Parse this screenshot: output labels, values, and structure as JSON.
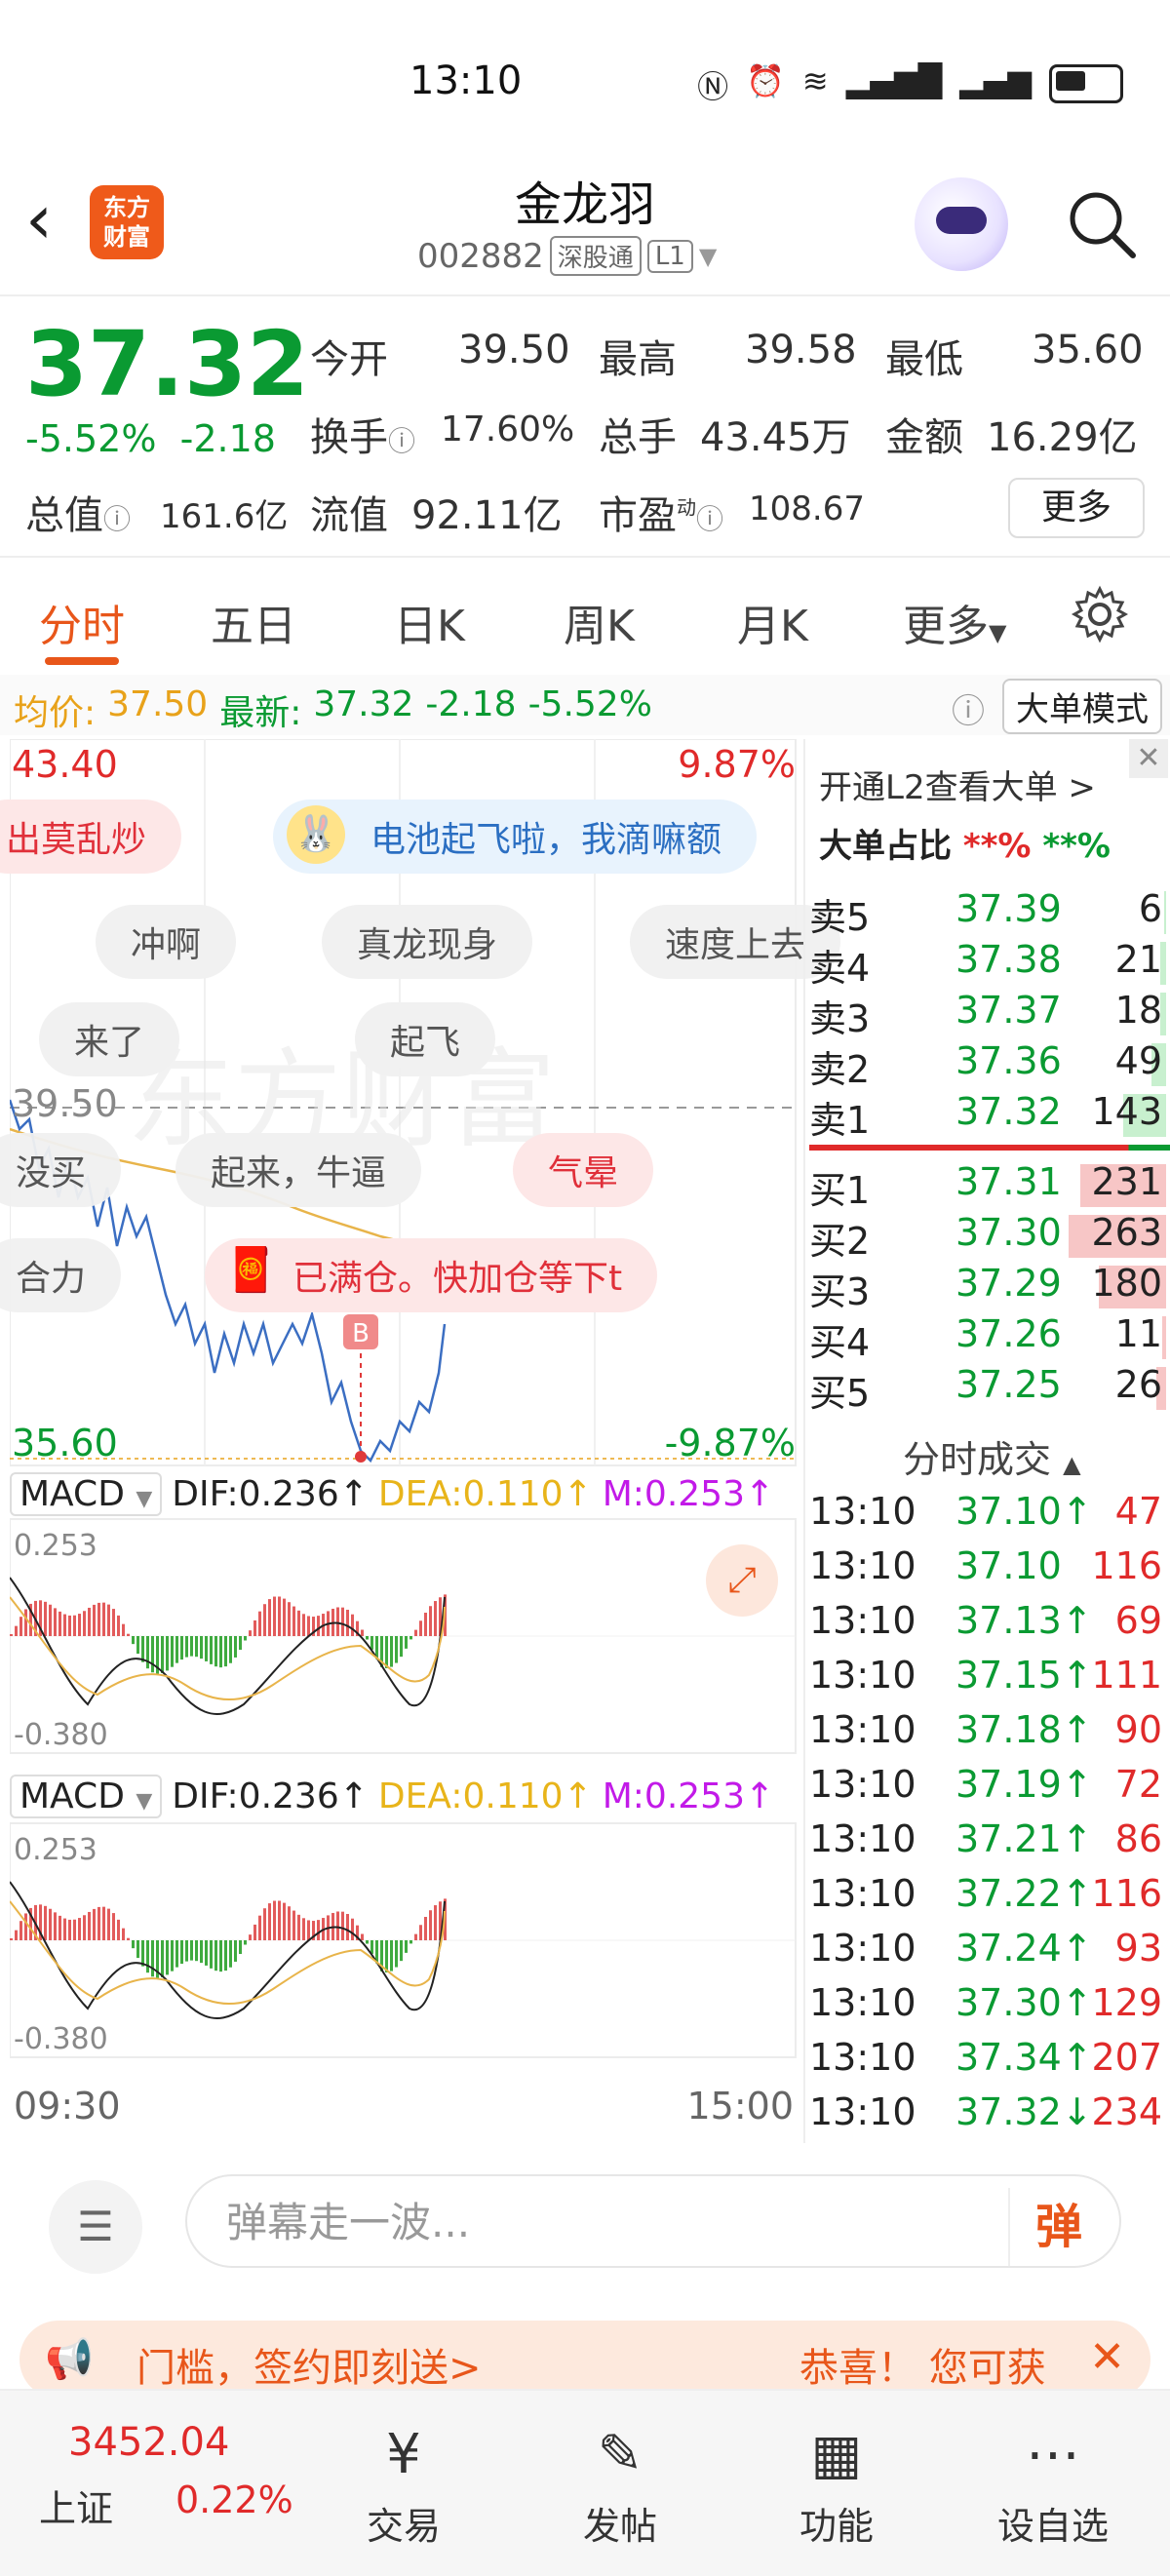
{
  "status": {
    "time": "13:10"
  },
  "header": {
    "title": "金龙羽",
    "code": "002882",
    "tag1": "深股通",
    "tag2": "L1",
    "logo_line1": "东方",
    "logo_line2": "财富"
  },
  "quote": {
    "price": "37.32",
    "pct": "-5.52%",
    "change": "-2.18",
    "open_label": "今开",
    "open": "39.50",
    "high_label": "最高",
    "high": "39.58",
    "low_label": "最低",
    "low": "35.60",
    "turnover_label": "换手",
    "turnover": "17.60%",
    "volume_label": "总手",
    "volume": "43.45万",
    "amount_label": "金额",
    "amount": "16.29亿",
    "mktcap_label": "总值",
    "mktcap": "161.6亿",
    "float_label": "流值",
    "float": "92.11亿",
    "pe_label": "市盈",
    "pe_sup": "动",
    "pe": "108.67",
    "more": "更多"
  },
  "tabs": [
    "分时",
    "五日",
    "日K",
    "周K",
    "月K",
    "更多",
    ""
  ],
  "info": {
    "avg_label": "均价:",
    "avg": "37.50",
    "latest_label": "最新:",
    "latest": "37.32",
    "chg": "-2.18",
    "pct": "-5.52%",
    "mode_btn": "大单模式"
  },
  "chart": {
    "ytop": "43.40",
    "ytop_pct": "9.87%",
    "yref": "39.50",
    "ybot": "35.60",
    "ybot_pct": "-9.87%",
    "xstart": "09:30",
    "xend": "15:00",
    "b_marker": "B",
    "danmu": [
      "出莫乱炒",
      "电池起飞啦，我滴嘛额",
      "冲啊",
      "真龙现身",
      "速度上去",
      "来了",
      "起飞",
      "没买",
      "起来，牛逼",
      "气晕",
      "合力",
      "已满仓。快加仓等下t"
    ],
    "watermark": "东方财富",
    "macd": {
      "name": "MACD",
      "dif": "DIF:0.236↑",
      "dea": "DEA:0.110↑",
      "m": "M:0.253↑",
      "top": "0.253",
      "bot": "-0.380"
    }
  },
  "orderbook": {
    "l2_link": "开通L2查看大单 >",
    "ratio_label": "大单占比",
    "ratio_red": "**%",
    "ratio_green": "**%",
    "asks": [
      {
        "label": "卖5",
        "price": "37.39",
        "vol": "6",
        "frac": 0.02
      },
      {
        "label": "卖4",
        "price": "37.38",
        "vol": "21",
        "frac": 0.08
      },
      {
        "label": "卖3",
        "price": "37.37",
        "vol": "18",
        "frac": 0.07
      },
      {
        "label": "卖2",
        "price": "37.36",
        "vol": "49",
        "frac": 0.19
      },
      {
        "label": "卖1",
        "price": "37.32",
        "vol": "143",
        "frac": 0.55
      }
    ],
    "bids": [
      {
        "label": "买1",
        "price": "37.31",
        "vol": "231",
        "frac": 0.88
      },
      {
        "label": "买2",
        "price": "37.30",
        "vol": "263",
        "frac": 1.0
      },
      {
        "label": "买3",
        "price": "37.29",
        "vol": "180",
        "frac": 0.69
      },
      {
        "label": "买4",
        "price": "37.26",
        "vol": "11",
        "frac": 0.04
      },
      {
        "label": "买5",
        "price": "37.25",
        "vol": "26",
        "frac": 0.1
      }
    ],
    "trades_title": "分时成交",
    "trades": [
      {
        "t": "13:10",
        "p": "37.10↑",
        "v": "47"
      },
      {
        "t": "13:10",
        "p": "37.10",
        "v": "116"
      },
      {
        "t": "13:10",
        "p": "37.13↑",
        "v": "69"
      },
      {
        "t": "13:10",
        "p": "37.15↑",
        "v": "111"
      },
      {
        "t": "13:10",
        "p": "37.18↑",
        "v": "90"
      },
      {
        "t": "13:10",
        "p": "37.19↑",
        "v": "72"
      },
      {
        "t": "13:10",
        "p": "37.21↑",
        "v": "86"
      },
      {
        "t": "13:10",
        "p": "37.22↑",
        "v": "116"
      },
      {
        "t": "13:10",
        "p": "37.24↑",
        "v": "93"
      },
      {
        "t": "13:10",
        "p": "37.30↑",
        "v": "129"
      },
      {
        "t": "13:10",
        "p": "37.34↑",
        "v": "207"
      },
      {
        "t": "13:10",
        "p": "37.32↓",
        "v": "234"
      }
    ]
  },
  "comment": {
    "placeholder": "弹幕走一波...",
    "danmu_btn": "弹"
  },
  "banner": {
    "left": "门槛，签约即刻送>",
    "right": "恭喜！ 您可获"
  },
  "nav": {
    "index_value": "3452.04",
    "index_name": "上证",
    "index_pct": "0.22%",
    "items": [
      "交易",
      "发帖",
      "功能",
      "设自选"
    ]
  }
}
